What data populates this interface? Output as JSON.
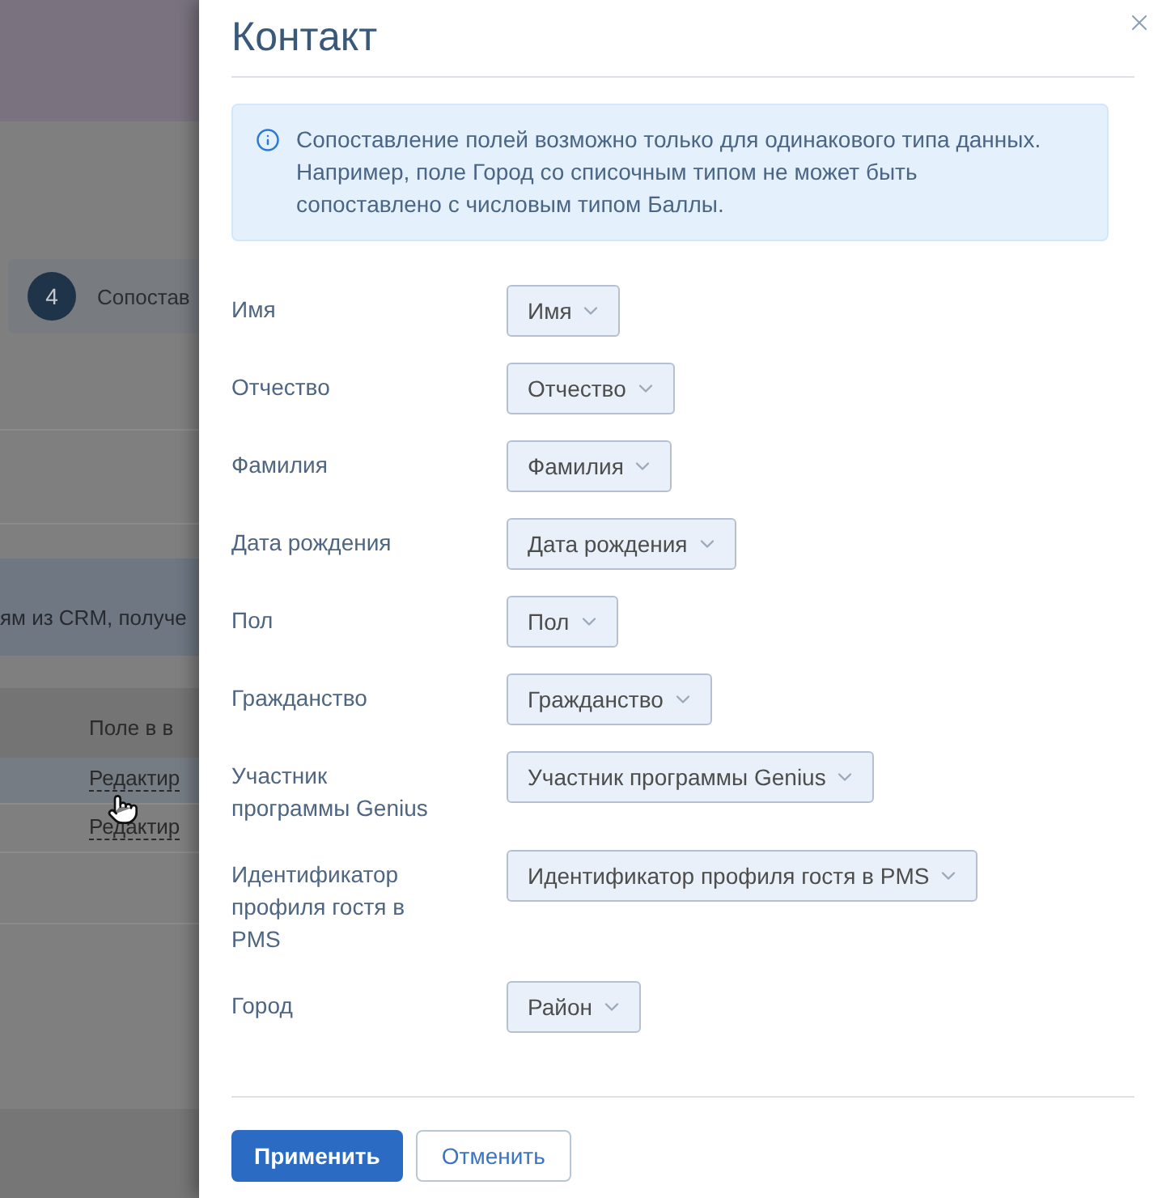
{
  "background": {
    "step": {
      "number": "4",
      "label": "Сопостав"
    },
    "notice": "ям из CRM, получе",
    "table": {
      "column_1": "Поле в в",
      "rows": [
        {
          "link": "Редактир",
          "hovered": true
        },
        {
          "link": "Редактир",
          "hovered": false
        }
      ]
    }
  },
  "dialog": {
    "title": "Контакт",
    "info": "Сопоставление полей возможно только для одинакового типа данных. Например, поле Город со списочным типом не может быть сопоставлено с числовым типом Баллы.",
    "fields": [
      {
        "label": "Имя",
        "value": "Имя"
      },
      {
        "label": "Отчество",
        "value": "Отчество"
      },
      {
        "label": "Фамилия",
        "value": "Фамилия"
      },
      {
        "label": "Дата рождения",
        "value": "Дата рождения"
      },
      {
        "label": "Пол",
        "value": "Пол"
      },
      {
        "label": "Гражданство",
        "value": "Гражданство"
      },
      {
        "label": "Участник программы Genius",
        "value": "Участник программы Genius"
      },
      {
        "label": "Идентификатор профиля гостя в PMS",
        "value": "Идентификатор профиля гостя в PMS"
      },
      {
        "label": "Город",
        "value": "Район"
      }
    ],
    "buttons": [
      {
        "label": "Применить",
        "kind": "primary"
      },
      {
        "label": "Отменить",
        "kind": "secondary"
      }
    ]
  }
}
